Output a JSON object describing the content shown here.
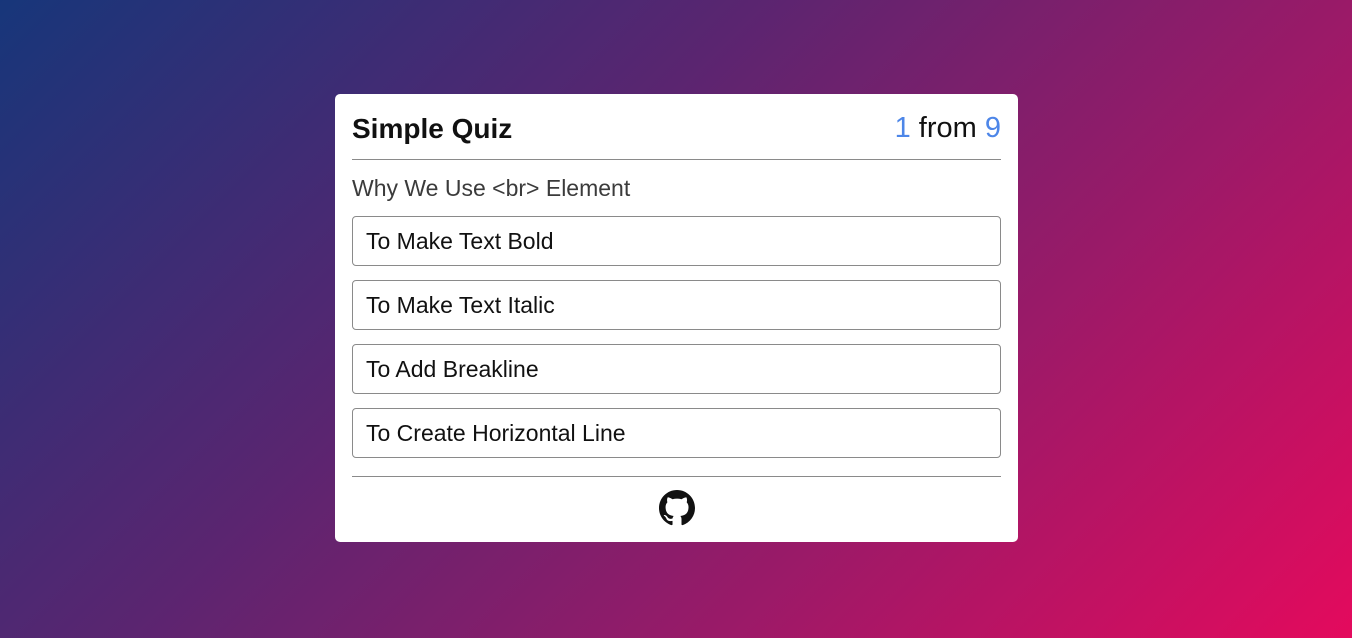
{
  "quiz": {
    "title": "Simple Quiz",
    "current": "1",
    "from_label": "from",
    "total": "9",
    "question": "Why We Use <br> Element",
    "options": [
      {
        "label": "To Make Text Bold"
      },
      {
        "label": "To Make Text Italic"
      },
      {
        "label": "To Add Breakline"
      },
      {
        "label": "To Create Horizontal Line"
      }
    ]
  },
  "footer": {
    "icon": "github-icon"
  }
}
